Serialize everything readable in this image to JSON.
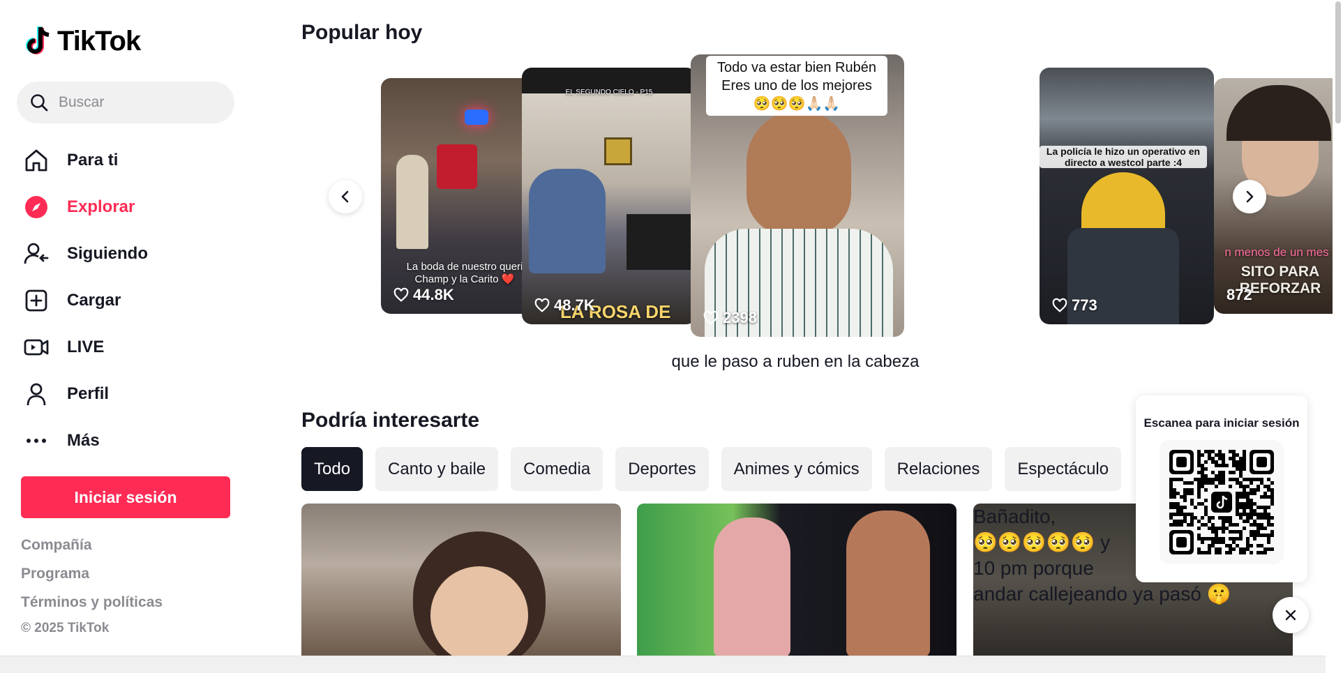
{
  "app": {
    "logo_text": "TikTok"
  },
  "search": {
    "placeholder": "Buscar"
  },
  "nav": [
    {
      "label": "Para ti",
      "icon": "home-icon"
    },
    {
      "label": "Explorar",
      "icon": "compass-icon",
      "active": true
    },
    {
      "label": "Siguiendo",
      "icon": "following-icon"
    },
    {
      "label": "Cargar",
      "icon": "upload-icon"
    },
    {
      "label": "LIVE",
      "icon": "live-icon"
    },
    {
      "label": "Perfil",
      "icon": "profile-icon"
    },
    {
      "label": "Más",
      "icon": "more-icon"
    }
  ],
  "login_button": "Iniciar sesión",
  "footer": {
    "links": [
      "Compañía",
      "Programa",
      "Términos y políticas"
    ],
    "copyright": "© 2025 TikTok"
  },
  "popular": {
    "title": "Popular hoy",
    "cards": [
      {
        "likes": "44.8K",
        "overlay": "La boda de nuestro queri\nChamp y la Carito ❤️"
      },
      {
        "likes": "48.7K",
        "overlay_top": "EL SEGUNDO CIELO - P15",
        "overlay": "LA ROSA DE"
      },
      {
        "likes": "2398",
        "overlay": "Todo va estar bien Rubén\nEres uno de los mejores\n🥺🥺🥺🙏🏻🙏🏻"
      },
      {
        "likes": "773",
        "overlay": "La policía le hizo un operativo\nen directo a westcol parte :4"
      },
      {
        "likes": "872",
        "overlay_top": "n menos de un mes",
        "overlay": "SITO PARA REFORZAR"
      }
    ],
    "caption": "que le paso a ruben en la cabeza"
  },
  "interests": {
    "title": "Podría interesarte",
    "chips": [
      "Todo",
      "Canto y baile",
      "Comedia",
      "Deportes",
      "Animes y cómics",
      "Relaciones",
      "Espectáculo"
    ],
    "thumb3_text": "Bañadito,\n🥺🥺🥺🥺🥺 y\n10 pm porque\nandar callejeando ya pasó 🤫"
  },
  "qr": {
    "title": "Escanea para iniciar sesión"
  },
  "colors": {
    "brand": "#fe2c55",
    "text": "#161823",
    "muted": "#8a8b91",
    "chip_bg": "#f1f1f2"
  }
}
